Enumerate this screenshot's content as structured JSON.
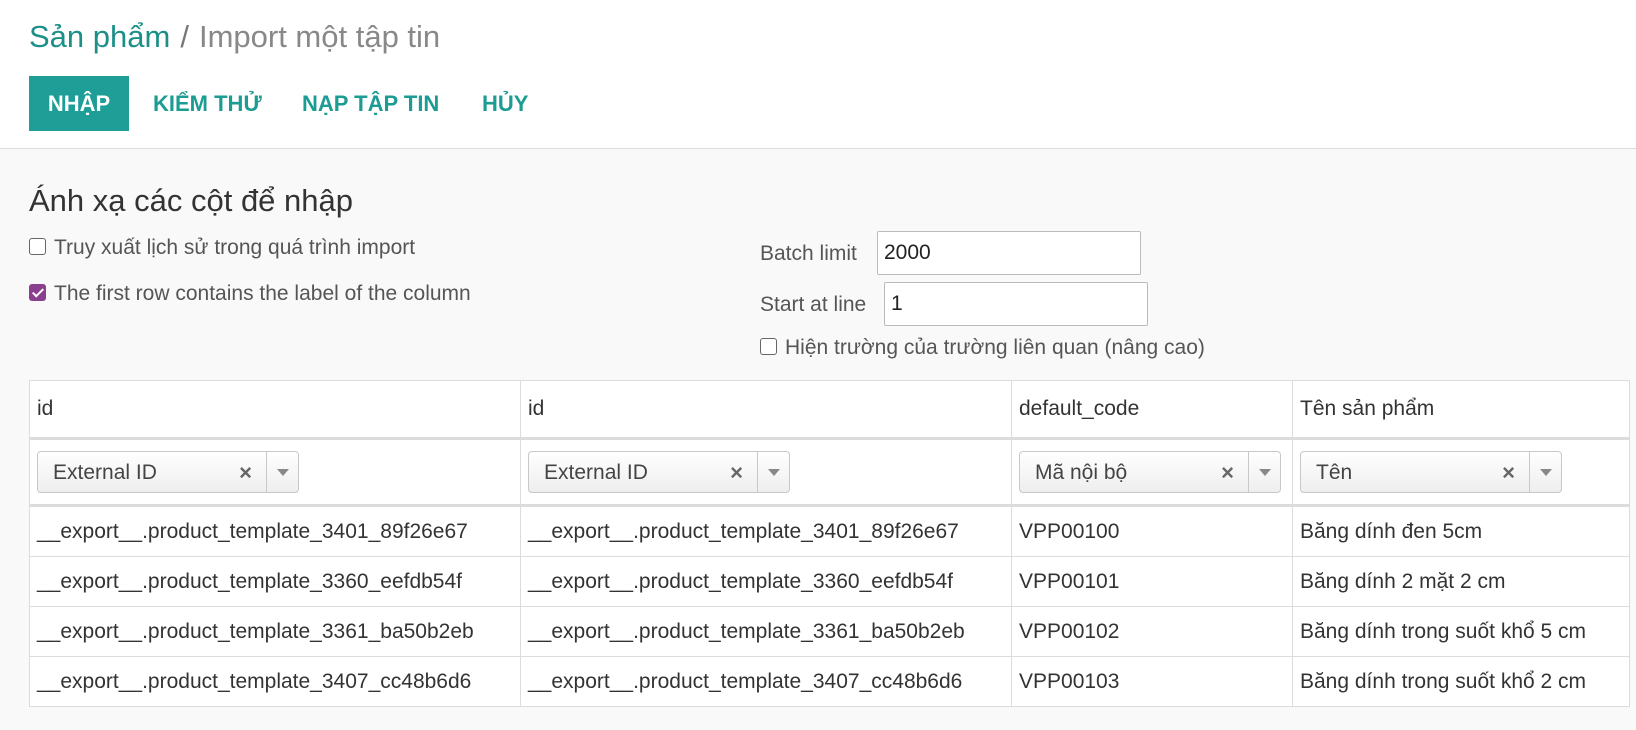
{
  "breadcrumb": {
    "parent": "Sản phẩm",
    "separator": "/",
    "current": "Import một tập tin"
  },
  "buttons": {
    "import": "NHẬP",
    "test": "KIỂM THỬ",
    "load": "NẠP TẬP TIN",
    "cancel": "HỦY"
  },
  "section_title": "Ánh xạ các cột để nhập",
  "options": {
    "track_history": {
      "label": "Truy xuất lịch sử trong quá trình import",
      "checked": false
    },
    "first_row_header": {
      "label": "The first row contains the label of the column",
      "checked": true
    },
    "show_advanced": {
      "label": "Hiện trường của trường liên quan (nâng cao)",
      "checked": false
    }
  },
  "batch_limit": {
    "label": "Batch limit",
    "value": "2000"
  },
  "start_line": {
    "label": "Start at line",
    "value": "1"
  },
  "table": {
    "headers": [
      "id",
      "id",
      "default_code",
      "Tên sản phẩm"
    ],
    "mappings": [
      "External ID",
      "External ID",
      "Mã nội bộ",
      "Tên"
    ],
    "clear_symbol": "×",
    "rows": [
      [
        "__export__.product_template_3401_89f26e67",
        "__export__.product_template_3401_89f26e67",
        "VPP00100",
        "Băng dính đen 5cm"
      ],
      [
        "__export__.product_template_3360_eefdb54f",
        "__export__.product_template_3360_eefdb54f",
        "VPP00101",
        "Băng dính 2 mặt 2 cm"
      ],
      [
        "__export__.product_template_3361_ba50b2eb",
        "__export__.product_template_3361_ba50b2eb",
        "VPP00102",
        "Băng dính trong suốt khổ 5 cm"
      ],
      [
        "__export__.product_template_3407_cc48b6d6",
        "__export__.product_template_3407_cc48b6d6",
        "VPP00103",
        "Băng dính trong suốt khổ 2 cm"
      ]
    ]
  },
  "colors": {
    "primary": "#1e9e96",
    "link": "#1c8f88",
    "checkbox_checked": "#8b3f8f"
  }
}
